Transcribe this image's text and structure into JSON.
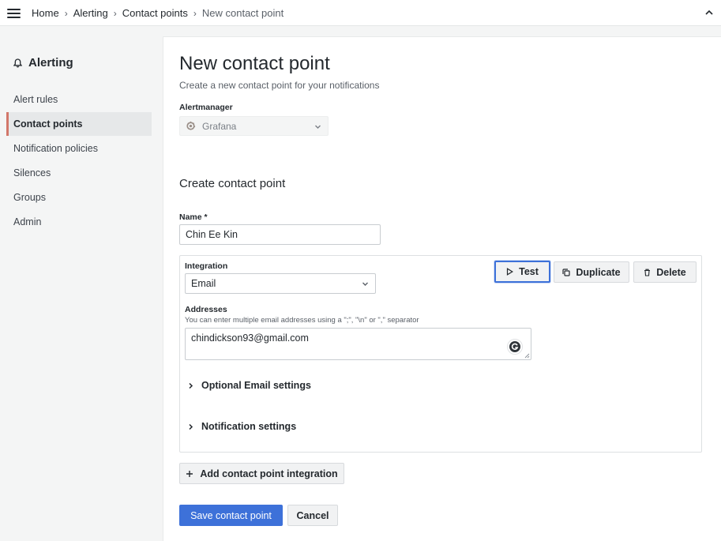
{
  "colors": {
    "primary": "#3d71d9",
    "active_marker": "#d2776a",
    "background": "#f4f5f5"
  },
  "breadcrumb": {
    "items": [
      "Home",
      "Alerting",
      "Contact points",
      "New contact point"
    ]
  },
  "sidebar": {
    "title": "Alerting",
    "title_icon": "bell-icon",
    "items": [
      {
        "label": "Alert rules"
      },
      {
        "label": "Contact points"
      },
      {
        "label": "Notification policies"
      },
      {
        "label": "Silences"
      },
      {
        "label": "Groups"
      },
      {
        "label": "Admin"
      }
    ],
    "active_item": "Contact points"
  },
  "page": {
    "title": "New contact point",
    "subtitle": "Create a new contact point for your notifications"
  },
  "alertmanager": {
    "label": "Alertmanager",
    "value": "Grafana",
    "icon": "grafana-logo-icon"
  },
  "form": {
    "section_title": "Create contact point",
    "name_label": "Name *",
    "name_value": "Chin Ee Kin"
  },
  "integration": {
    "label": "Integration",
    "value": "Email",
    "test_label": "Test",
    "duplicate_label": "Duplicate",
    "delete_label": "Delete",
    "addresses_label": "Addresses",
    "addresses_description": "You can enter multiple email addresses using a \";\", \"\\n\" or \",\" separator",
    "addresses_value": "chindickson93@gmail.com",
    "optional_settings_label": "Optional Email settings",
    "notification_settings_label": "Notification settings"
  },
  "actions": {
    "add_integration_label": "Add contact point integration",
    "save_label": "Save contact point",
    "cancel_label": "Cancel"
  }
}
